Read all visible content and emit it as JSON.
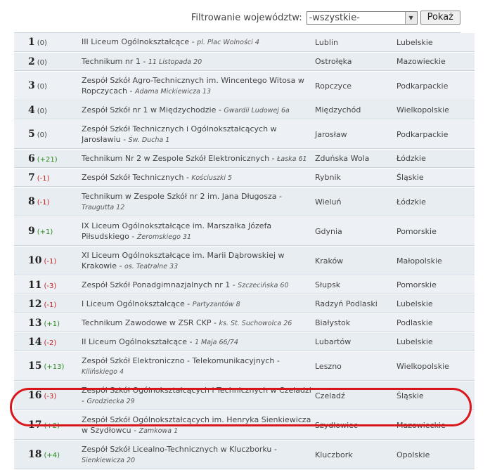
{
  "filter": {
    "label": "Filtrowanie województw:",
    "selected": "-wszystkie-",
    "button": "Pokaż"
  },
  "rows": [
    {
      "rank": "1",
      "change": "(0)",
      "trend": "neutral",
      "school": "III Liceum Ogólnokształcące",
      "address": "pl. Plac Wolności 4",
      "city": "Lublin",
      "region": "Lubelskie",
      "h": 27
    },
    {
      "rank": "2",
      "change": "(0)",
      "trend": "neutral",
      "school": "Technikum nr 1",
      "address": "11 Listopada 20",
      "city": "Ostrołęka",
      "region": "Mazowieckie",
      "h": 27
    },
    {
      "rank": "3",
      "change": "(0)",
      "trend": "neutral",
      "school": "Zespół Szkół Agro-Technicznych im. Wincentego Witosa w Ropczycach",
      "address": "Adama Mickiewicza 13",
      "city": "Ropczyce",
      "region": "Podkarpackie",
      "h": 40
    },
    {
      "rank": "4",
      "change": "(0)",
      "trend": "neutral",
      "school": "Zespół Szkół nr 1 w Międzychodzie",
      "address": "Gwardii Ludowej 6a",
      "city": "Międzychód",
      "region": "Wielkopolskie",
      "h": 27
    },
    {
      "rank": "5",
      "change": "(0)",
      "trend": "neutral",
      "school": "Zespół Szkół Technicznych i Ogólnokształcących w Jarosławiu",
      "address": "Św. Ducha 1",
      "city": "Jarosław",
      "region": "Podkarpackie",
      "h": 40
    },
    {
      "rank": "6",
      "change": "(+21)",
      "trend": "up",
      "school": "Technikum Nr 2 w Zespole Szkół Elektronicznych",
      "address": "Łaska 61",
      "city": "Zduńska Wola",
      "region": "Łódzkie",
      "h": 27
    },
    {
      "rank": "7",
      "change": "(-1)",
      "trend": "down",
      "school": "Zespół Szkół Technicznych",
      "address": "Kościuszki 5",
      "city": "Rybnik",
      "region": "Śląskie",
      "h": 27
    },
    {
      "rank": "8",
      "change": "(-1)",
      "trend": "down",
      "school": "Technikum w Zespole Szkół nr 2 im. Jana Długosza",
      "address": "Traugutta 12",
      "city": "Wieluń",
      "region": "Łódzkie",
      "h": 27
    },
    {
      "rank": "9",
      "change": "(+1)",
      "trend": "up",
      "school": "IX Liceum Ogólnokształcące im. Marszałka Józefa Piłsudskiego",
      "address": "Żeromskiego 31",
      "city": "Gdynia",
      "region": "Pomorskie",
      "h": 40
    },
    {
      "rank": "10",
      "change": "(-1)",
      "trend": "down",
      "school": "XI Liceum Ogólnokształcące im. Marii Dąbrowskiej w Krakowie",
      "address": "os. Teatralne 33",
      "city": "Kraków",
      "region": "Małopolskie",
      "h": 40
    },
    {
      "rank": "11",
      "change": "(-3)",
      "trend": "down",
      "school": "Zespół Szkół Ponadgimnazjalnych nr 1",
      "address": "Szczecińska 60",
      "city": "Słupsk",
      "region": "Pomorskie",
      "h": 27
    },
    {
      "rank": "12",
      "change": "(-1)",
      "trend": "down",
      "school": "I Liceum Ogólnokształcące",
      "address": "Partyzantów 8",
      "city": "Radzyń Podlaski",
      "region": "Lubelskie",
      "h": 27
    },
    {
      "rank": "13",
      "change": "(+1)",
      "trend": "up",
      "school": "Technikum Zawodowe w ZSR CKP",
      "address": "ks. St. Suchowolca 26",
      "city": "Białystok",
      "region": "Podlaskie",
      "h": 27
    },
    {
      "rank": "14",
      "change": "(-2)",
      "trend": "down",
      "school": "II Liceum Ogólnokształcące",
      "address": "1 Maja 66/74",
      "city": "Lubartów",
      "region": "Lubelskie",
      "h": 27
    },
    {
      "rank": "15",
      "change": "(+13)",
      "trend": "up",
      "school": "Zespół Szkół Elektroniczno - Telekomunikacyjnych",
      "address": "Kilińskiego 4",
      "city": "Leszno",
      "region": "Wielkopolskie",
      "h": 27
    },
    {
      "rank": "16",
      "change": "(-3)",
      "trend": "down",
      "school": "Zespół Szkół Ogólnokształcących i Technicznych w Czeladzi",
      "address": "Grodziecka 29",
      "city": "Czeladź",
      "region": "Śląskie",
      "h": 40
    },
    {
      "rank": "17",
      "change": "(+2)",
      "trend": "up",
      "school": "Zespół Szkół Ogólnokształcących im. Henryka Sienkiewicza w Szydłowcu",
      "address": "Zamkowa 1",
      "city": "Szydłowiec",
      "region": "Mazowieckie",
      "h": 40
    },
    {
      "rank": "18",
      "change": "(+4)",
      "trend": "up",
      "school": "Zespół Szkół Licealno-Technicznych w Kluczborku",
      "address": "Sienkiewicza 20",
      "city": "Kluczbork",
      "region": "Opolskie",
      "h": 40
    }
  ],
  "colors": {
    "up": "#2a8a1c",
    "down": "#c81e1e",
    "highlight": "#d9161c"
  }
}
